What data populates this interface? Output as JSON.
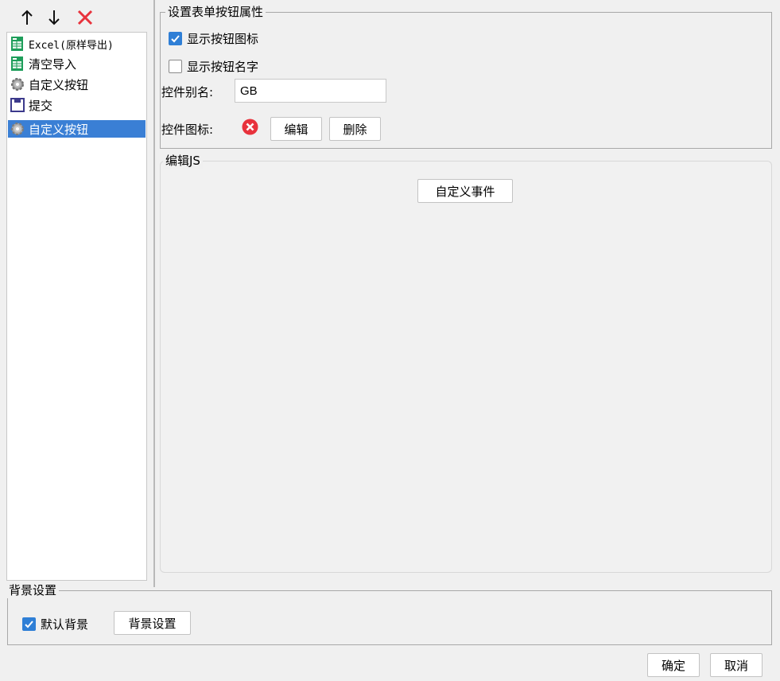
{
  "toolbar": {
    "up_icon": "arrow-up-icon",
    "down_icon": "arrow-down-icon",
    "delete_icon": "red-x-delete-icon"
  },
  "list": {
    "items": [
      {
        "label": "Excel(原样导出)",
        "icon": "excel-icon"
      },
      {
        "label": "清空导入",
        "icon": "excel-icon"
      },
      {
        "label": "自定义按钮",
        "icon": "gear-icon"
      },
      {
        "label": "提交",
        "icon": "save-disk-icon"
      },
      {
        "label": "自定义按钮",
        "icon": "gear-icon",
        "selected": true
      }
    ]
  },
  "props": {
    "title": "设置表单按钮属性",
    "show_icon_label": "显示按钮图标",
    "show_icon_checked": true,
    "show_name_label": "显示按钮名字",
    "show_name_checked": false,
    "alias_label": "控件别名:",
    "alias_value": "GB",
    "icon_label": "控件图标:",
    "edit_button": "编辑",
    "delete_button": "删除"
  },
  "js": {
    "title": "编辑JS",
    "custom_event_button": "自定义事件"
  },
  "background": {
    "title": "背景设置",
    "default_label": "默认背景",
    "default_checked": true,
    "settings_button": "背景设置"
  },
  "footer": {
    "ok_button": "确定",
    "cancel_button": "取消"
  },
  "colors": {
    "selection": "#3a7fd5",
    "checkbox": "#2f7fd6",
    "delete_red": "#e8323c"
  }
}
